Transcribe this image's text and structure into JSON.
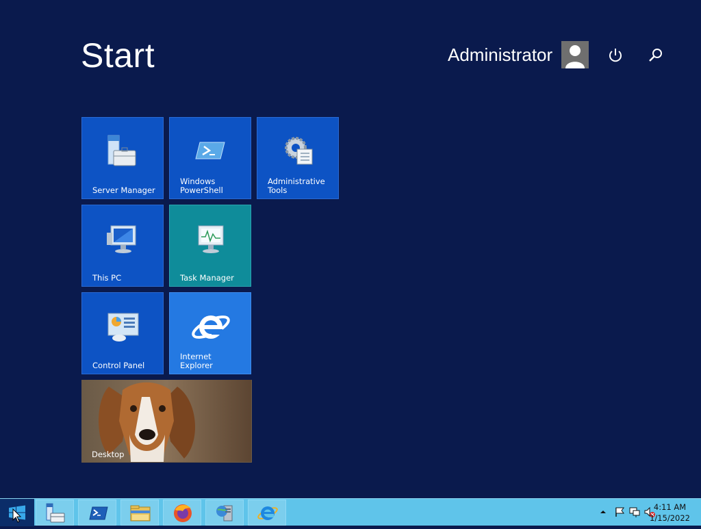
{
  "header": {
    "title": "Start",
    "user_name": "Administrator",
    "power_icon": "power-icon",
    "search_icon": "search-icon"
  },
  "tiles": [
    {
      "label": "Server Manager",
      "icon": "server-manager-icon",
      "color": "#0d53c4"
    },
    {
      "label": "Windows PowerShell",
      "icon": "powershell-icon",
      "color": "#0d53c4"
    },
    {
      "label": "Administrative Tools",
      "icon": "admin-tools-icon",
      "color": "#0d53c4"
    },
    {
      "label": "This PC",
      "icon": "computer-icon",
      "color": "#0d53c4"
    },
    {
      "label": "Task Manager",
      "icon": "task-manager-icon",
      "color": "#0f8c9a"
    },
    {
      "label": "Control Panel",
      "icon": "control-panel-icon",
      "color": "#0d53c4"
    },
    {
      "label": "Internet Explorer",
      "icon": "internet-explorer-icon",
      "color": "#2479e2"
    },
    {
      "label": "Desktop",
      "icon": "desktop-wallpaper",
      "color": "#6d5a44"
    }
  ],
  "taskbar": {
    "apps": [
      "server-manager-icon",
      "powershell-icon",
      "file-explorer-icon",
      "firefox-icon",
      "network-icon",
      "internet-explorer-icon"
    ],
    "clock_time": "4:11 AM",
    "clock_date": "1/15/2022",
    "background": "#5fc4ea"
  }
}
